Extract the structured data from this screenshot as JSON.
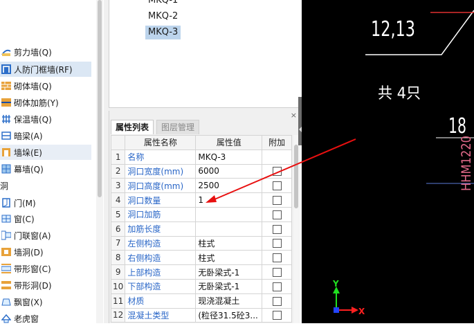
{
  "nav": {
    "items": [
      {
        "label": "剪力墙(Q)",
        "icon": "shear-wall-icon"
      },
      {
        "label": "人防门框墙(RF)",
        "icon": "civil-defense-door-frame-wall-icon"
      },
      {
        "label": "砌体墙(Q)",
        "icon": "masonry-wall-icon"
      },
      {
        "label": "砌体加筋(Y)",
        "icon": "masonry-reinforcement-icon"
      },
      {
        "label": "保温墙(Q)",
        "icon": "insulation-wall-icon"
      },
      {
        "label": "暗梁(A)",
        "icon": "concealed-beam-icon"
      },
      {
        "label": "墙垛(E)",
        "icon": "wall-pier-icon"
      },
      {
        "label": "幕墙(Q)",
        "icon": "curtain-wall-icon"
      },
      {
        "label": "洞",
        "icon": ""
      },
      {
        "label": "门(M)",
        "icon": "door-icon"
      },
      {
        "label": "窗(C)",
        "icon": "window-icon"
      },
      {
        "label": "门联窗(A)",
        "icon": "door-window-icon"
      },
      {
        "label": "墙洞(D)",
        "icon": "wall-opening-icon"
      },
      {
        "label": "带形窗(C)",
        "icon": "strip-window-icon"
      },
      {
        "label": "带形洞(D)",
        "icon": "strip-opening-icon"
      },
      {
        "label": "飘窗(X)",
        "icon": "bay-window-icon"
      },
      {
        "label": "老虎窗",
        "icon": "dormer-window-icon"
      }
    ]
  },
  "component_list": {
    "items": [
      "MKQ-1",
      "MKQ-2",
      "MKQ-3"
    ],
    "selected": "MKQ-3"
  },
  "properties": {
    "close_glyph": "×",
    "tabs": [
      {
        "label": "属性列表",
        "active": true
      },
      {
        "label": "图层管理",
        "active": false
      }
    ],
    "columns": [
      "",
      "属性名称",
      "属性值",
      "附加"
    ],
    "rows": [
      {
        "idx": "1",
        "name": "名称",
        "value": "MKQ-3",
        "linked": true,
        "checkbox": false
      },
      {
        "idx": "2",
        "name": "洞口宽度(mm)",
        "value": "6000",
        "linked": true,
        "checkbox": true
      },
      {
        "idx": "3",
        "name": "洞口高度(mm)",
        "value": "2500",
        "linked": true,
        "checkbox": true
      },
      {
        "idx": "4",
        "name": "洞口数量",
        "value": "1",
        "linked": true,
        "checkbox": true
      },
      {
        "idx": "5",
        "name": "洞口加筋",
        "value": "",
        "linked": true,
        "checkbox": true
      },
      {
        "idx": "6",
        "name": "加筋长度",
        "value": "",
        "linked": true,
        "checkbox": true
      },
      {
        "idx": "7",
        "name": "左侧构造",
        "value": "柱式",
        "linked": true,
        "checkbox": true
      },
      {
        "idx": "8",
        "name": "右侧构造",
        "value": "柱式",
        "linked": true,
        "checkbox": true
      },
      {
        "idx": "9",
        "name": "上部构造",
        "value": "无卧梁式-1",
        "linked": true,
        "checkbox": true
      },
      {
        "idx": "10",
        "name": "下部构造",
        "value": "无卧梁式-1",
        "linked": true,
        "checkbox": true
      },
      {
        "idx": "11",
        "name": "材质",
        "value": "现浇混凝土",
        "linked": true,
        "checkbox": true
      },
      {
        "idx": "12",
        "name": "混凝土类型",
        "value": "(粒径31.5砼3...",
        "linked": true,
        "checkbox": true
      }
    ]
  },
  "cad": {
    "texts": [
      {
        "id": "dim-1213",
        "text": "12,13",
        "color": "#ffffff"
      },
      {
        "id": "count-4",
        "text": "共 4只",
        "color": "#ffffff"
      },
      {
        "id": "num-18",
        "text": "18",
        "color": "#ffffff"
      },
      {
        "id": "hhm",
        "text": "HHM1220",
        "color": "#e26a8a"
      }
    ],
    "ucs": {
      "x_label": "X",
      "y_label": "Y",
      "x_color": "#ff2020",
      "y_color": "#20e020"
    },
    "arrow_color": "#e81010"
  }
}
